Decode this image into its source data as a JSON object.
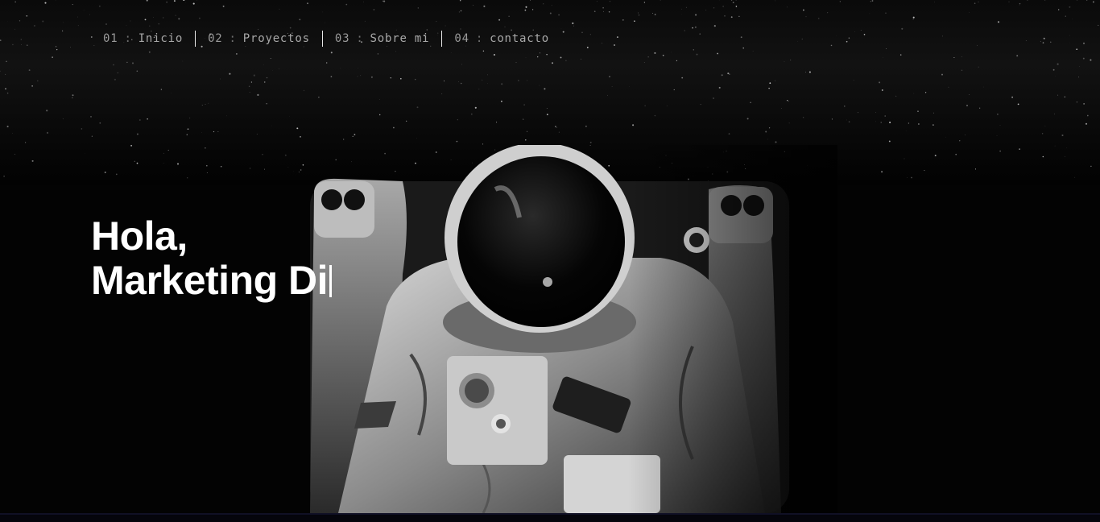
{
  "nav": {
    "items": [
      {
        "number": "01",
        "separator": ":",
        "label": "Inicio"
      },
      {
        "number": "02",
        "separator": ":",
        "label": "Proyectos"
      },
      {
        "number": "03",
        "separator": ":",
        "label": "Sobre mi"
      },
      {
        "number": "04",
        "separator": ":",
        "label": "contacto"
      }
    ]
  },
  "hero": {
    "greeting": "Hola,",
    "typed_text": "Marketing Di"
  },
  "colors": {
    "background": "#000000",
    "headline": "#ffffff",
    "nav_text": "#9a9a9a",
    "nav_separator": "#e8e8e8"
  },
  "images": {
    "hero_photo": "astronaut-in-space-black-and-white",
    "background": "starfield"
  }
}
